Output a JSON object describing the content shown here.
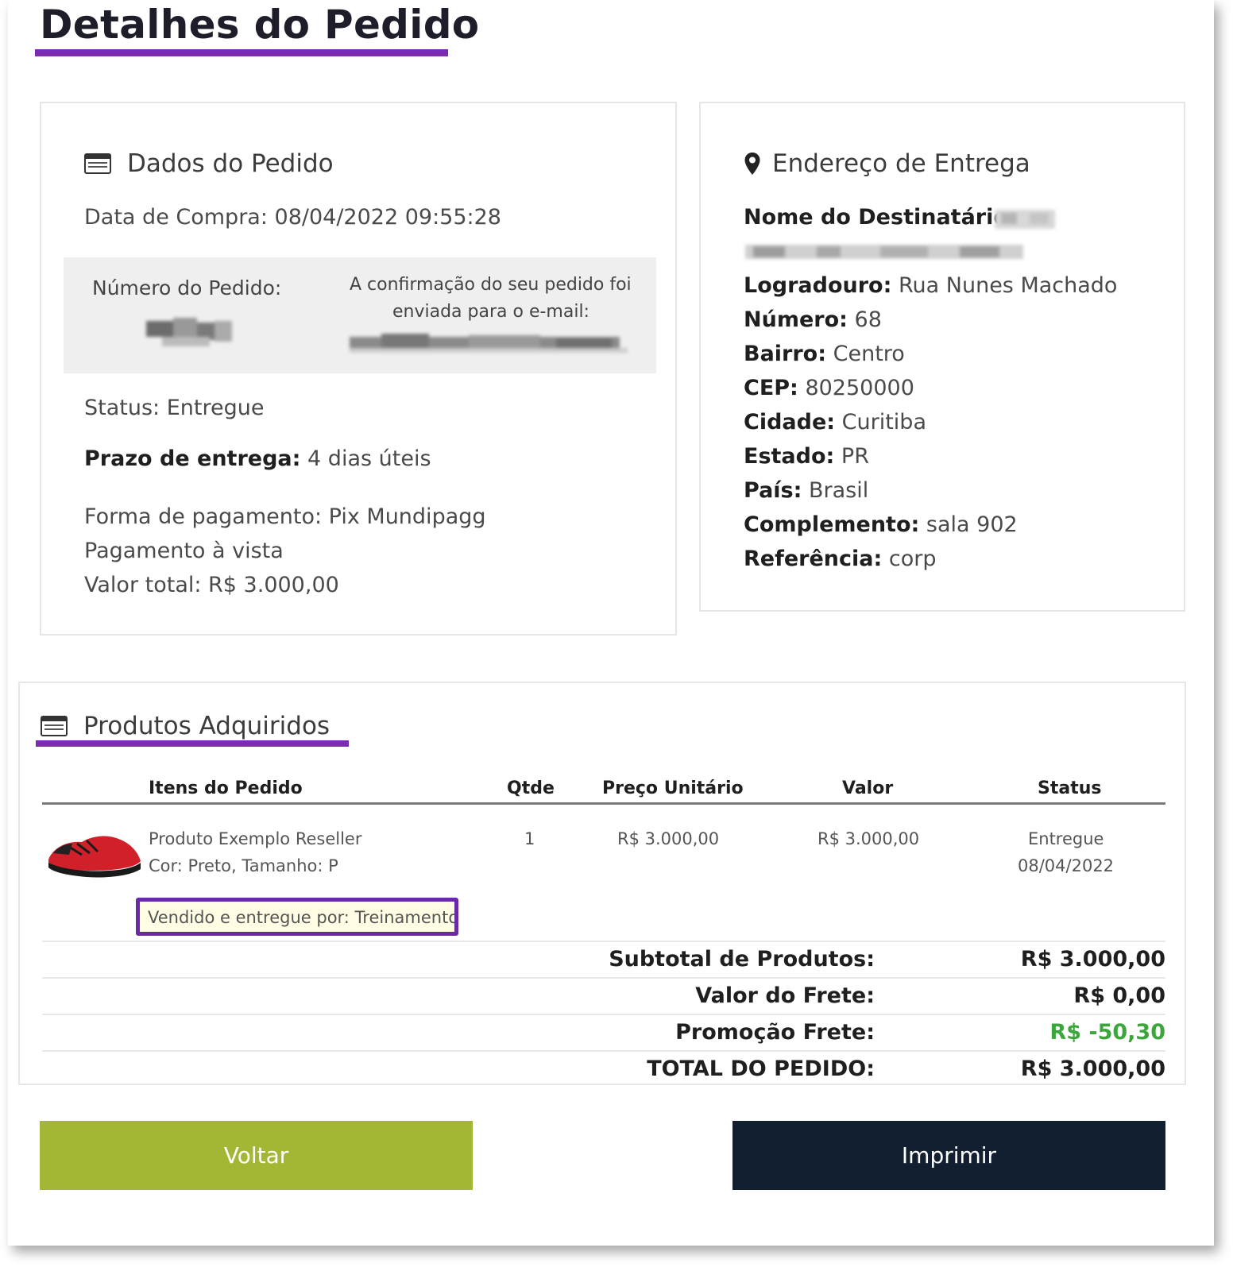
{
  "page": {
    "title": "Detalhes do Pedido"
  },
  "order": {
    "heading": "Dados do Pedido",
    "purchase_date": "Data de Compra: 08/04/2022 09:55:28",
    "order_number_label": "Número do Pedido:",
    "confirmation_text_1": "A confirmação do seu pedido foi",
    "confirmation_text_2": "enviada para o e-mail:",
    "status": "Status: Entregue",
    "delivery_label": "Prazo de entrega:",
    "delivery_value": "4 dias úteis",
    "payment_method": "Forma de pagamento: Pix Mundipagg",
    "payment_terms": "Pagamento à vista",
    "total_value": "Valor total: R$ 3.000,00"
  },
  "address": {
    "heading": "Endereço de Entrega",
    "fields": [
      {
        "label": "Nome do Destinatário:",
        "value": ""
      },
      {
        "label": "Logradouro:",
        "value": "Rua Nunes Machado"
      },
      {
        "label": "Número:",
        "value": "68"
      },
      {
        "label": "Bairro:",
        "value": "Centro"
      },
      {
        "label": "CEP:",
        "value": "80250000"
      },
      {
        "label": "Cidade:",
        "value": "Curitiba"
      },
      {
        "label": "Estado:",
        "value": "PR"
      },
      {
        "label": "País:",
        "value": "Brasil"
      },
      {
        "label": "Complemento:",
        "value": "sala 902"
      },
      {
        "label": "Referência:",
        "value": "corp"
      }
    ]
  },
  "products": {
    "heading": "Produtos Adquiridos",
    "columns": [
      "Itens do Pedido",
      "Qtde",
      "Preço Unitário",
      "Valor",
      "Status"
    ],
    "item": {
      "name": "Produto Exemplo Reseller",
      "variant": "Cor: Preto, Tamanho: P",
      "qty": "1",
      "unit_price": "R$ 3.000,00",
      "value": "R$ 3.000,00",
      "status": "Entregue",
      "status_date": "08/04/2022",
      "sold_by": "Vendido e entregue por: Treinamento"
    },
    "summary": [
      {
        "label": "Subtotal de Produtos:",
        "value": "R$ 3.000,00"
      },
      {
        "label": "Valor do Frete:",
        "value": "R$ 0,00"
      },
      {
        "label": "Promoção Frete:",
        "value": "R$ -50,30"
      },
      {
        "label": "TOTAL DO PEDIDO:",
        "value": "R$ 3.000,00"
      }
    ]
  },
  "buttons": {
    "back": "Voltar",
    "print": "Imprimir"
  },
  "colors": {
    "accent": "#7b2cb2",
    "back_button": "#a4b634",
    "print_button": "#121f31",
    "discount": "#3ca63c"
  },
  "icons": {
    "order": "card-icon",
    "address": "map-pin-icon",
    "products": "card-icon"
  }
}
